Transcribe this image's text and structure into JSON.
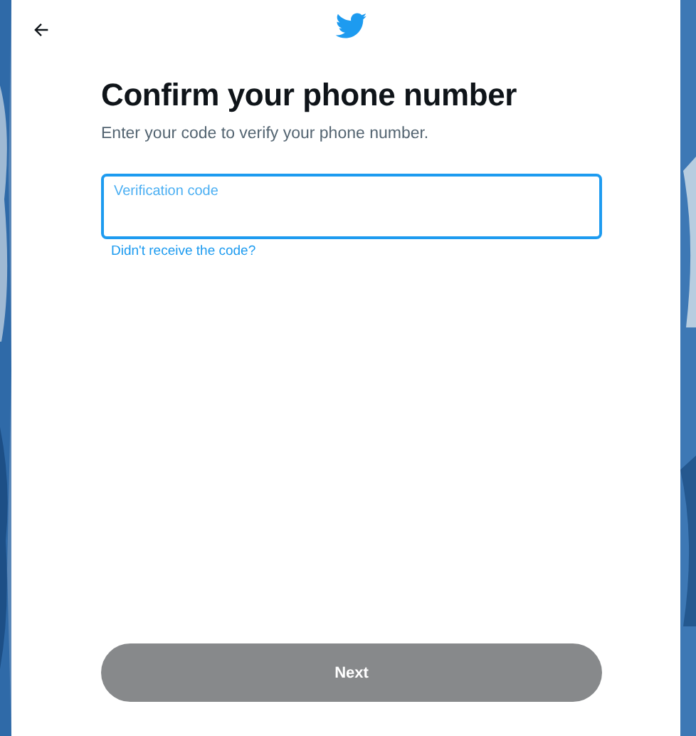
{
  "dialog": {
    "title": "Confirm your phone number",
    "subtitle": "Enter your code to verify your phone number.",
    "code_field": {
      "placeholder": "Verification code",
      "focused": true
    },
    "help_link": "Didn't receive the code?",
    "next_button": {
      "label": "Next",
      "disabled": true
    }
  }
}
